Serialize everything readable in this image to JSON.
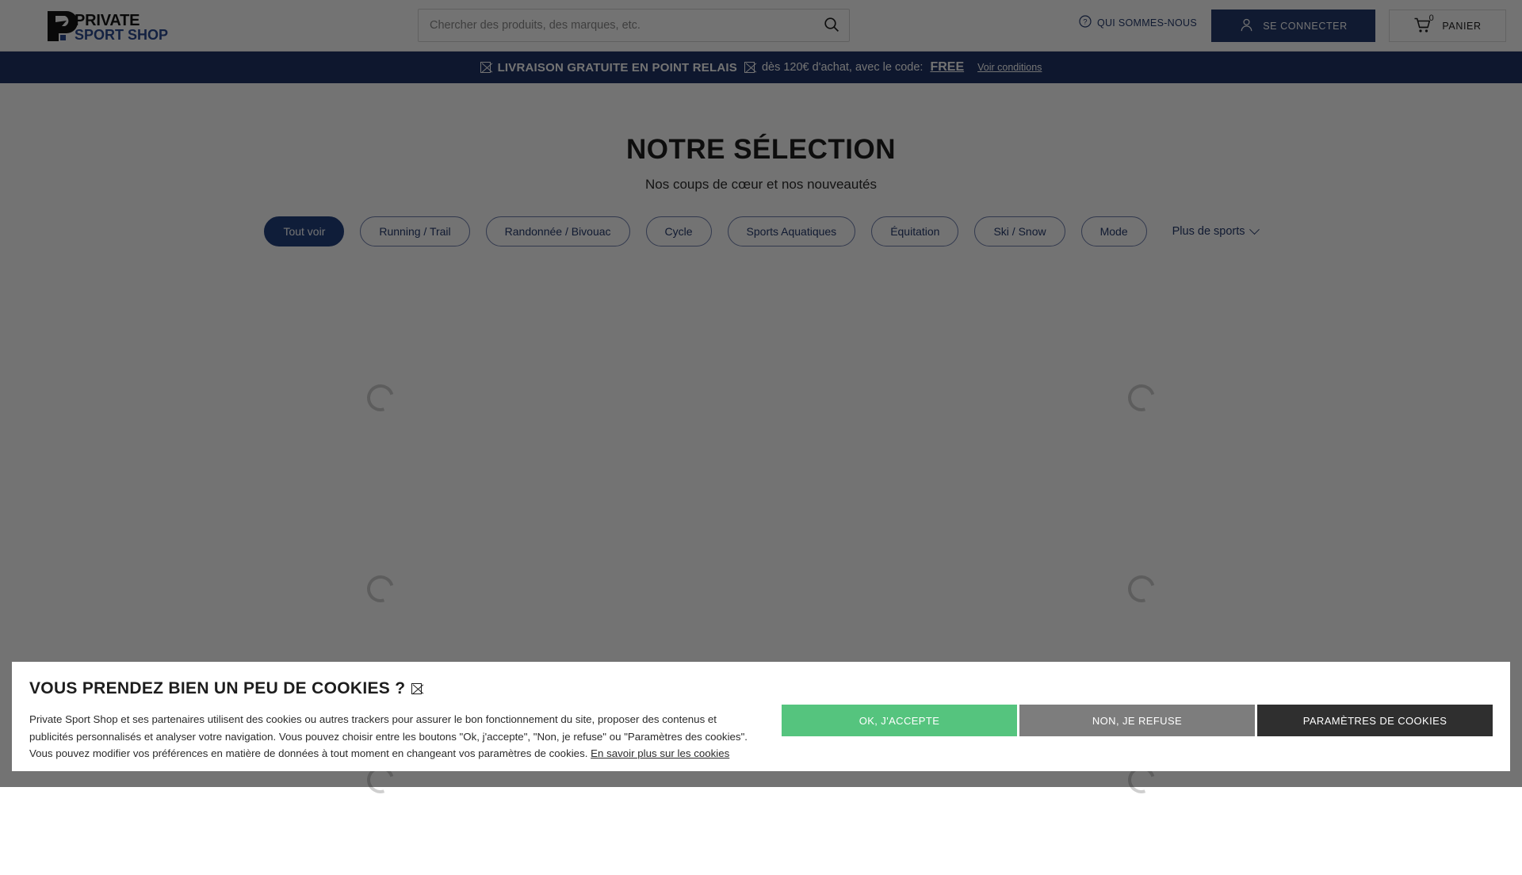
{
  "header": {
    "logo_top": "PRIVATE",
    "logo_bottom": "SPORT SHOP",
    "search": {
      "placeholder": "Chercher des produits, des marques, etc.",
      "value": ""
    },
    "about_label": "QUI SOMMES-NOUS",
    "login_label": "SE CONNECTER",
    "cart_label": "PANIER",
    "cart_count": "0"
  },
  "promo": {
    "strong": "LIVRAISON GRATUITE EN POINT RELAIS",
    "rest": "dès 120€ d'achat, avec le code:",
    "code": "FREE",
    "conditions": "Voir conditions"
  },
  "main": {
    "title": "NOTRE SÉLECTION",
    "subtitle": "Nos coups de cœur et nos nouveautés",
    "pills": [
      {
        "label": "Tout voir",
        "active": true
      },
      {
        "label": "Running / Trail",
        "active": false
      },
      {
        "label": "Randonnée / Bivouac",
        "active": false
      },
      {
        "label": "Cycle",
        "active": false
      },
      {
        "label": "Sports Aquatiques",
        "active": false
      },
      {
        "label": "Équitation",
        "active": false
      },
      {
        "label": "Ski / Snow",
        "active": false
      },
      {
        "label": "Mode",
        "active": false
      }
    ],
    "more_sports_label": "Plus de sports"
  },
  "cookie": {
    "title": "VOUS PRENDEZ BIEN UN PEU DE COOKIES ?",
    "paragraph": "Private Sport Shop et ses partenaires utilisent des cookies ou autres trackers pour assurer le bon fonctionnement du site, proposer des contenus et publicités personnalisés et analyser votre navigation. Vous pouvez choisir entre les boutons \"Ok, j'accepte\", \"Non, je refuse\" ou \"Paramètres des cookies\". Vous pouvez modifier vos préférences en matière de données à tout moment en changeant vos paramètres de cookies.",
    "link": "En savoir plus sur les cookies",
    "accept_label": "OK, J'ACCEPTE",
    "refuse_label": "NON, JE REFUSE",
    "params_label": "PARAMÈTRES DE COOKIES"
  },
  "colors": {
    "brand_navy": "#1f3466",
    "accent_blue": "#23407f",
    "accept_green": "#55c47e",
    "refuse_grey": "#7d7d7d",
    "params_dark": "#2f2f2f"
  }
}
